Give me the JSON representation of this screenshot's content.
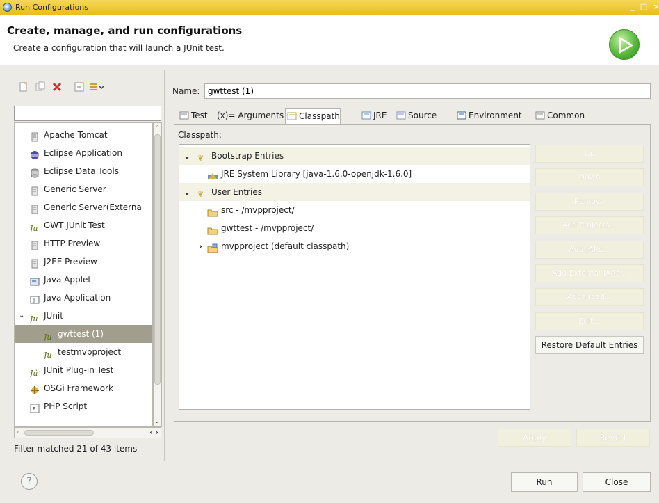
{
  "window": {
    "title": "Run Configurations",
    "controls": {
      "minimize": "_",
      "maximize": "□",
      "close": "×"
    }
  },
  "header": {
    "title": "Create, manage, and run configurations",
    "subtitle": "Create a configuration that will launch a JUnit test."
  },
  "left": {
    "toolbar_icons": [
      "new-launch-config-icon",
      "duplicate-icon",
      "delete-icon",
      "collapse-all-icon",
      "filter-icon"
    ],
    "filter_placeholder": "",
    "tree": [
      {
        "label": "Apache Tomcat",
        "icon": "server-icon"
      },
      {
        "label": "Eclipse Application",
        "icon": "eclipse-icon"
      },
      {
        "label": "Eclipse Data Tools",
        "icon": "database-icon"
      },
      {
        "label": "Generic Server",
        "icon": "server-icon"
      },
      {
        "label": "Generic Server(Externa",
        "icon": "server-icon"
      },
      {
        "label": "GWT JUnit Test",
        "icon": "junit-icon"
      },
      {
        "label": "HTTP Preview",
        "icon": "server-icon"
      },
      {
        "label": "J2EE Preview",
        "icon": "server-icon"
      },
      {
        "label": "Java Applet",
        "icon": "applet-icon"
      },
      {
        "label": "Java Application",
        "icon": "java-app-icon"
      },
      {
        "label": "JUnit",
        "icon": "junit-icon"
      },
      {
        "label": "gwttest (1)",
        "icon": "junit-icon"
      },
      {
        "label": "testmvpproject",
        "icon": "junit-icon"
      },
      {
        "label": "JUnit Plug-in Test",
        "icon": "junit-plugin-icon"
      },
      {
        "label": "OSGi Framework",
        "icon": "osgi-icon"
      },
      {
        "label": "PHP Script",
        "icon": "php-icon"
      }
    ],
    "filter_status": "Filter matched 21 of 43 items"
  },
  "right": {
    "name_label": "Name:",
    "name_value": "gwttest (1)",
    "tabs": [
      {
        "label": "Test",
        "icon": "test-tab-icon"
      },
      {
        "label": "(x)= Arguments",
        "icon": "arguments-icon"
      },
      {
        "label": "Classpath",
        "icon": "classpath-icon"
      },
      {
        "label": "JRE",
        "icon": "jre-icon"
      },
      {
        "label": "Source",
        "icon": "source-icon"
      },
      {
        "label": "Environment",
        "icon": "environment-icon"
      },
      {
        "label": "Common",
        "icon": "common-icon"
      }
    ],
    "classpath_label": "Classpath:",
    "classpath_entries": [
      {
        "label": "Bootstrap Entries",
        "icon": "entries-folder-icon"
      },
      {
        "label": "JRE System Library [java-1.6.0-openjdk-1.6.0]",
        "icon": "library-icon"
      },
      {
        "label": "User Entries",
        "icon": "entries-folder-icon"
      },
      {
        "label": "src - /mvpproject/",
        "icon": "folder-icon"
      },
      {
        "label": "gwttest - /mvpproject/",
        "icon": "folder-icon"
      },
      {
        "label": "mvpproject (default classpath)",
        "icon": "project-folder-icon"
      }
    ],
    "side_buttons": {
      "up": "Up",
      "down": "Down",
      "remove": "Remove",
      "add_projects": "Add Projects...",
      "add_jars": "Add JARs...",
      "add_external_jars": "Add External JARs...",
      "advanced": "Advanced...",
      "edit": "Edit...",
      "restore": "Restore Default Entries"
    },
    "apply": "Apply",
    "revert": "Revert"
  },
  "footer": {
    "help": "?",
    "run": "Run",
    "close": "Close"
  },
  "colors": {
    "titlebar": "#e9bd1c",
    "selection": "#a29e8e",
    "group_row": "#f4f2e4",
    "run_logo": "#58b93a"
  }
}
